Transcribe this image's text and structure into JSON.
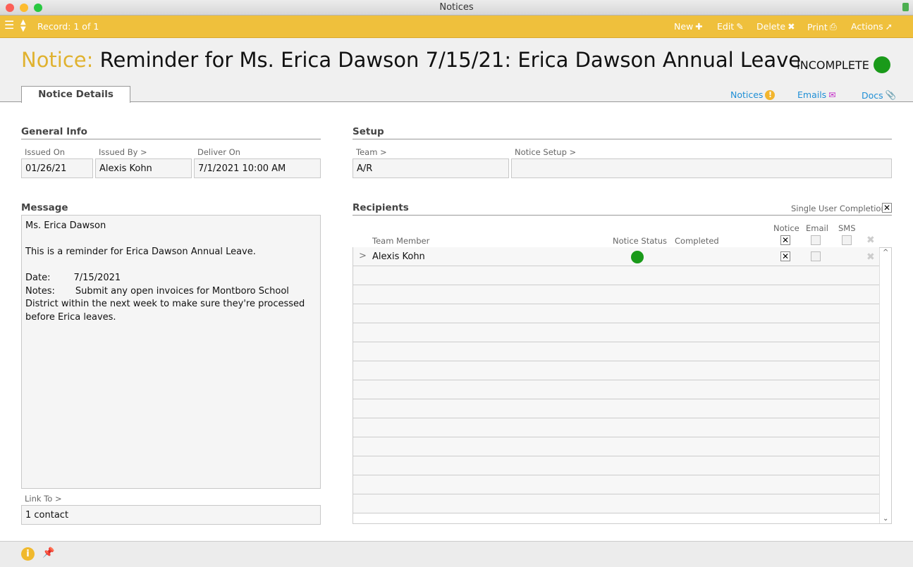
{
  "window": {
    "title": "Notices"
  },
  "toolbar": {
    "record": "Record: 1 of 1",
    "new": "New",
    "edit": "Edit",
    "delete": "Delete",
    "print": "Print",
    "actions": "Actions",
    "accent": "#efc03c"
  },
  "header": {
    "prefix": "Notice:",
    "title": "Reminder for Ms. Erica Dawson 7/15/21: Erica Dawson Annual Leave",
    "status": "INCOMPLETE",
    "status_color": "#1a9a1a"
  },
  "tabs": [
    {
      "label": "Notice Details",
      "active": true
    }
  ],
  "related": {
    "notices": "Notices",
    "emails": "Emails",
    "docs": "Docs"
  },
  "general": {
    "title": "General Info",
    "issued_on_label": "Issued On",
    "issued_on": "01/26/21",
    "issued_by_label": "Issued By >",
    "issued_by": "Alexis Kohn",
    "deliver_on_label": "Deliver On",
    "deliver_on": "7/1/2021 10:00 AM"
  },
  "setup": {
    "title": "Setup",
    "team_label": "Team >",
    "team": "A/R",
    "notice_setup_label": "Notice Setup >",
    "notice_setup": ""
  },
  "message": {
    "title": "Message",
    "lines": [
      "Ms. Erica Dawson",
      "",
      "This is a reminder for Erica Dawson Annual Leave.",
      "",
      "Date:        7/15/2021",
      "Notes:       Submit any open invoices for Montboro School",
      "District within the next week to make sure they're processed",
      "before Erica leaves."
    ],
    "link_to_label": "Link To >",
    "link_to": "1 contact"
  },
  "recipients": {
    "title": "Recipients",
    "single_user_label": "Single User Completion",
    "single_user": true,
    "columns": {
      "member": "Team Member",
      "status": "Notice Status",
      "completed": "Completed",
      "notice": "Notice",
      "email": "Email",
      "sms": "SMS"
    },
    "header_checks": {
      "notice": true,
      "email": false,
      "sms": false
    },
    "rows": [
      {
        "member": "Alexis Kohn",
        "status": "complete",
        "completed": "",
        "notice": true,
        "email": false
      }
    ]
  }
}
